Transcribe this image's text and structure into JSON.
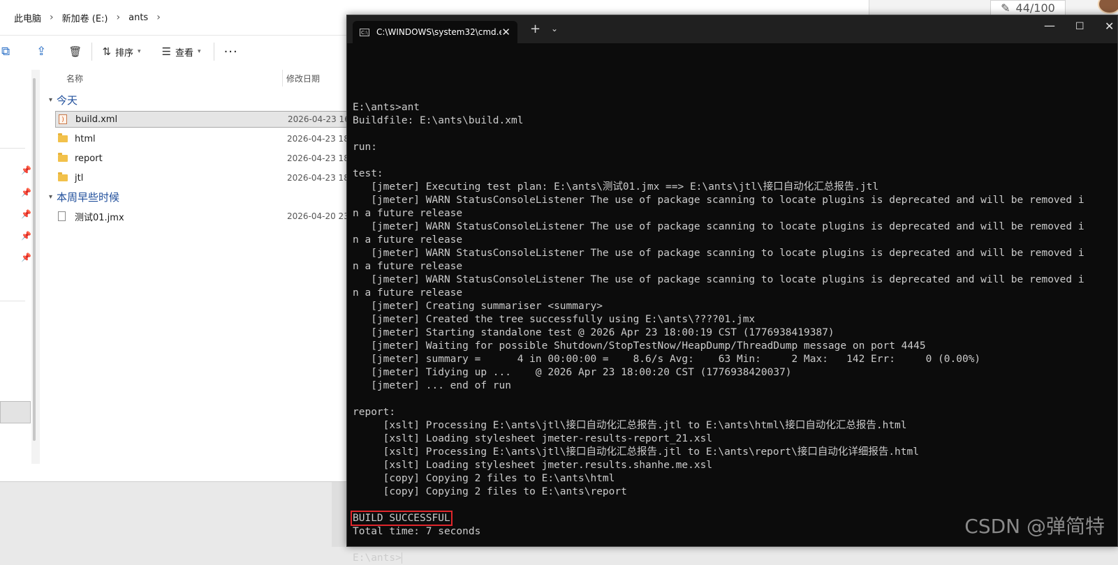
{
  "explorer": {
    "breadcrumb": [
      "此电脑",
      "新加卷 (E:)",
      "ants"
    ],
    "toolbar": {
      "sort_label": "排序",
      "view_label": "查看",
      "more_label": "···"
    },
    "columns": {
      "name": "名称",
      "date": "修改日期"
    },
    "groups": [
      {
        "label": "今天",
        "items": [
          {
            "name": "build.xml",
            "date": "2026-04-23 16:",
            "type": "xml-file-icon"
          },
          {
            "name": "html",
            "date": "2026-04-23 18:",
            "type": "folder-icon"
          },
          {
            "name": "report",
            "date": "2026-04-23 18:",
            "type": "folder-icon"
          },
          {
            "name": "jtl",
            "date": "2026-04-23 18:",
            "type": "folder-icon"
          }
        ]
      },
      {
        "label": "本周早些时候",
        "items": [
          {
            "name": "测试01.jmx",
            "date": "2026-04-20 23:",
            "type": "file-icon"
          }
        ]
      }
    ]
  },
  "background": {
    "counter": "44/100"
  },
  "terminal": {
    "tab_title": "C:\\WINDOWS\\system32\\cmd.e",
    "tab_icon": "C:\\",
    "lines_before": [
      "",
      "E:\\ants>ant",
      "Buildfile: E:\\ants\\build.xml",
      "",
      "run:",
      "",
      "test:",
      "   [jmeter] Executing test plan: E:\\ants\\测试01.jmx ==> E:\\ants\\jtl\\接口自动化汇总报告.jtl",
      "   [jmeter] WARN StatusConsoleListener The use of package scanning to locate plugins is deprecated and will be removed i",
      "n a future release",
      "   [jmeter] WARN StatusConsoleListener The use of package scanning to locate plugins is deprecated and will be removed i",
      "n a future release",
      "   [jmeter] WARN StatusConsoleListener The use of package scanning to locate plugins is deprecated and will be removed i",
      "n a future release",
      "   [jmeter] WARN StatusConsoleListener The use of package scanning to locate plugins is deprecated and will be removed i",
      "n a future release",
      "   [jmeter] Creating summariser <summary>",
      "   [jmeter] Created the tree successfully using E:\\ants\\????01.jmx",
      "   [jmeter] Starting standalone test @ 2026 Apr 23 18:00:19 CST (1776938419387)",
      "   [jmeter] Waiting for possible Shutdown/StopTestNow/HeapDump/ThreadDump message on port 4445",
      "   [jmeter] summary =      4 in 00:00:00 =    8.6/s Avg:    63 Min:     2 Max:   142 Err:     0 (0.00%)",
      "   [jmeter] Tidying up ...    @ 2026 Apr 23 18:00:20 CST (1776938420037)",
      "   [jmeter] ... end of run",
      "",
      "report:",
      "     [xslt] Processing E:\\ants\\jtl\\接口自动化汇总报告.jtl to E:\\ants\\html\\接口自动化汇总报告.html",
      "     [xslt] Loading stylesheet jmeter-results-report_21.xsl",
      "     [xslt] Processing E:\\ants\\jtl\\接口自动化汇总报告.jtl to E:\\ants\\report\\接口自动化详细报告.html",
      "     [xslt] Loading stylesheet jmeter.results.shanhe.me.xsl",
      "     [copy] Copying 2 files to E:\\ants\\html",
      "     [copy] Copying 2 files to E:\\ants\\report",
      ""
    ],
    "build_status": "BUILD SUCCESSFUL",
    "total_time": "Total time: 7 seconds",
    "prompt": "E:\\ants>"
  },
  "watermark": "CSDN @弹简特"
}
